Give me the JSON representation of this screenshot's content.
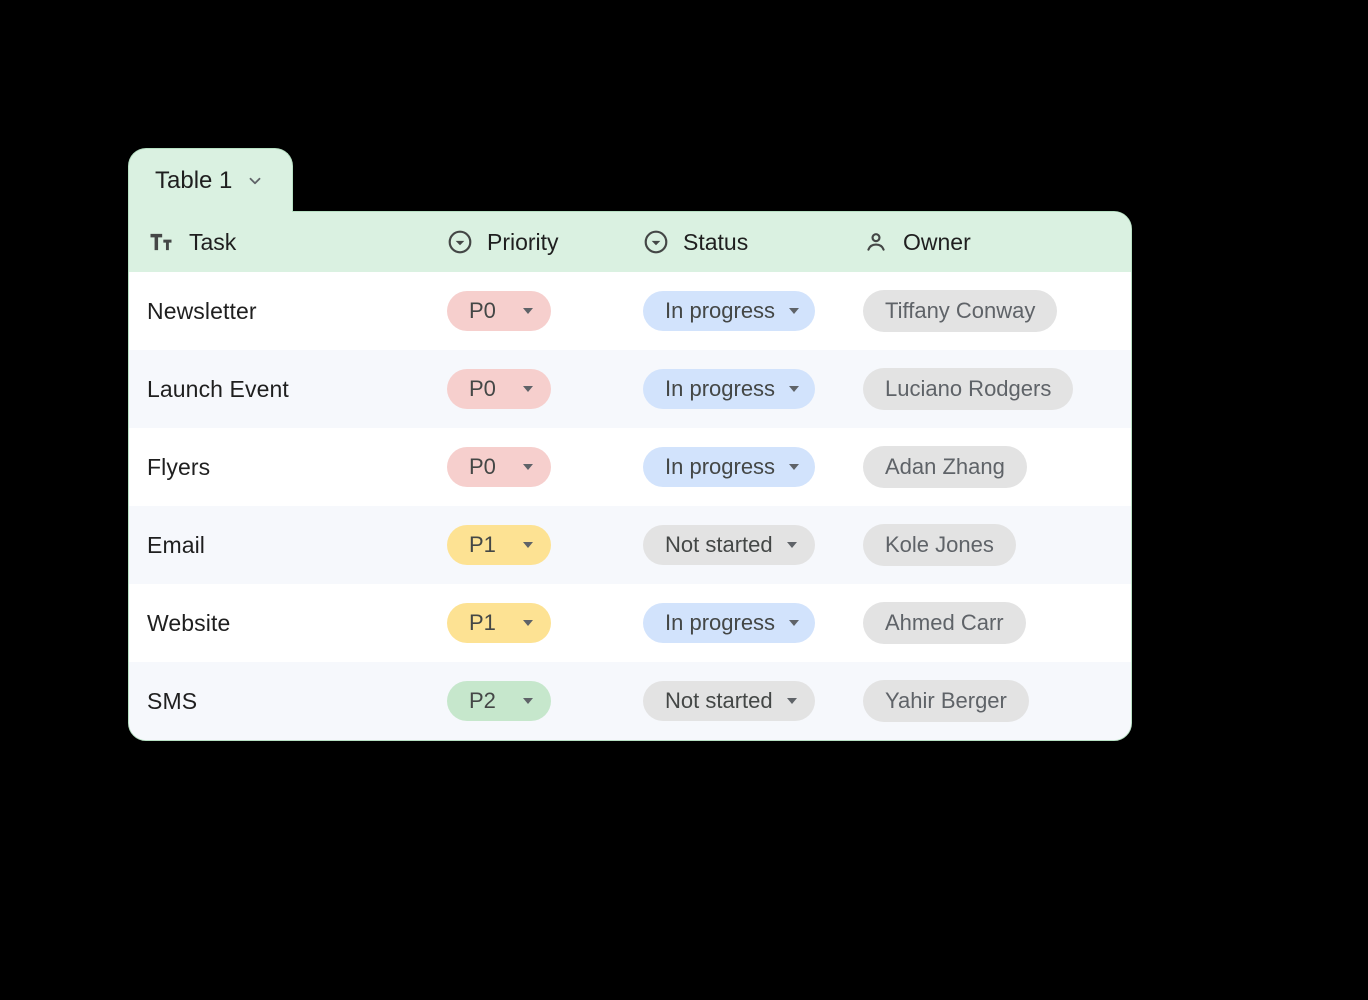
{
  "tab": {
    "title": "Table 1"
  },
  "columns": {
    "task": "Task",
    "priority": "Priority",
    "status": "Status",
    "owner": "Owner"
  },
  "priority_colors": {
    "P0": "chip-p0",
    "P1": "chip-p1",
    "P2": "chip-p2"
  },
  "status_colors": {
    "In progress": "chip-prog",
    "Not started": "chip-ns"
  },
  "rows": [
    {
      "task": "Newsletter",
      "priority": "P0",
      "status": "In progress",
      "owner": "Tiffany Conway"
    },
    {
      "task": "Launch Event",
      "priority": "P0",
      "status": "In progress",
      "owner": "Luciano Rodgers"
    },
    {
      "task": "Flyers",
      "priority": "P0",
      "status": "In progress",
      "owner": "Adan Zhang"
    },
    {
      "task": "Email",
      "priority": "P1",
      "status": "Not started",
      "owner": "Kole Jones"
    },
    {
      "task": "Website",
      "priority": "P1",
      "status": "In progress",
      "owner": "Ahmed Carr"
    },
    {
      "task": "SMS",
      "priority": "P2",
      "status": "Not started",
      "owner": "Yahir Berger"
    }
  ]
}
